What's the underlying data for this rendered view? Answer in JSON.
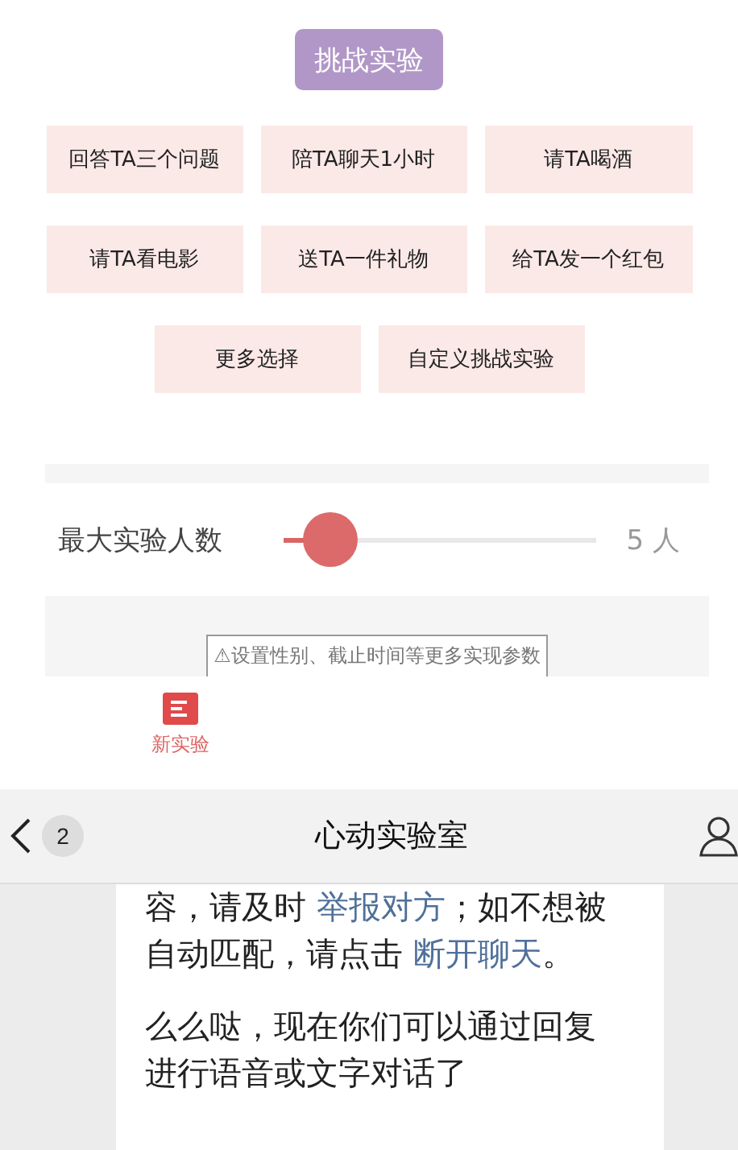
{
  "challenge_button": {
    "label": "挑战实验"
  },
  "options": [
    {
      "label": "回答TA三个问题"
    },
    {
      "label": "陪TA聊天1小时"
    },
    {
      "label": "请TA喝酒"
    },
    {
      "label": "请TA看电影"
    },
    {
      "label": "送TA一件礼物"
    },
    {
      "label": "给TA发一个红包"
    },
    {
      "label": "更多选择"
    },
    {
      "label": "自定义挑战实验"
    }
  ],
  "max_people": {
    "label": "最大实验人数",
    "level": 0.15,
    "reading": "5 人"
  },
  "more_settings": {
    "label": "⚠设置性别、截止时间等更多实现参数"
  },
  "tab": {
    "label": "新实验"
  },
  "chat_header": {
    "back": "2",
    "title": "心动实验室"
  },
  "messages": [
    {
      "segments": [
        {
          "kind": "text",
          "text": "容，请及时 "
        },
        {
          "kind": "link",
          "text": "举报对方"
        },
        {
          "kind": "text",
          "text": "；如不想被自动匹配，请点击 "
        },
        {
          "kind": "link",
          "text": "断开聊天"
        },
        {
          "kind": "text",
          "text": "。"
        }
      ]
    },
    {
      "segments": [
        {
          "kind": "text",
          "text": "么么哒，现在你们可以通过回复进行语音或文字对话了"
        }
      ]
    }
  ]
}
